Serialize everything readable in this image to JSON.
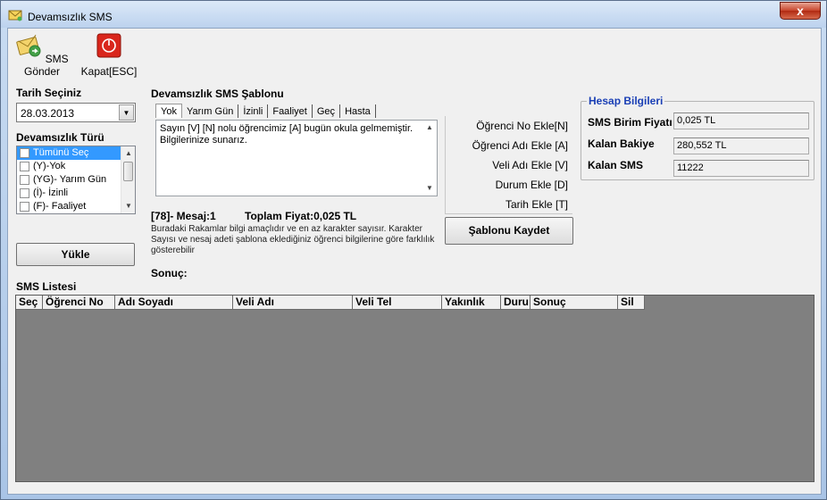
{
  "window": {
    "title": "Devamsızlık SMS",
    "close_glyph": "x"
  },
  "toolbar": {
    "send": {
      "label": "SMS Gönder",
      "icon": "envelope-send-icon"
    },
    "close": {
      "label": "Kapat[ESC]",
      "icon": "red-power-icon"
    }
  },
  "date": {
    "label": "Tarih Seçiniz",
    "value": "28.03.2013"
  },
  "absence_type": {
    "label": "Devamsızlık Türü",
    "items": [
      "Tümünü Seç",
      "(Y)-Yok",
      "(YG)- Yarım Gün",
      "(İ)- İzinli",
      "(F)- Faaliyet"
    ]
  },
  "load_button": "Yükle",
  "template": {
    "label": "Devamsızlık SMS Şablonu",
    "tabs": [
      "Yok",
      "Yarım Gün",
      "İzinli",
      "Faaliyet",
      "Geç",
      "Hasta"
    ],
    "text": "Sayın [V]  [N] nolu öğrencimiz [A]  bugün okula gelmemiştir. Bilgilerinize sunarız."
  },
  "insert_buttons": [
    "Öğrenci No Ekle[N]",
    "Öğrenci Adı Ekle [A]",
    "Veli Adı Ekle [V]",
    "Durum Ekle [D]",
    "Tarih Ekle [T]"
  ],
  "save_template": "Şablonu Kaydet",
  "message_info": {
    "count": "[78]- Mesaj:1",
    "total": "Toplam Fiyat:0,025 TL",
    "note": "Buradaki Rakamlar bilgi amaçlıdır ve en az karakter sayısır. Karakter Sayısı ve nesaj adeti şablona eklediğiniz öğrenci bilgilerine göre farklılık gösterebilir"
  },
  "result_label": "Sonuç:",
  "account": {
    "legend": "Hesap Bilgileri",
    "unit_price_label": "SMS Birim Fiyatı",
    "unit_price": "0,025 TL",
    "balance_label": "Kalan Bakiye",
    "balance": "280,552 TL",
    "sms_left_label": "Kalan SMS",
    "sms_left": "11222"
  },
  "sms_list": {
    "label": "SMS Listesi",
    "columns": [
      "Seç",
      "Öğrenci No",
      "Adı Soyadı",
      "Veli Adı",
      "Veli Tel",
      "Yakınlık",
      "Duru",
      "Sonuç",
      "Sil"
    ]
  },
  "colors": {
    "accent": "#1a3fb5",
    "grid_bg": "#808080",
    "selection": "#3399ff"
  }
}
